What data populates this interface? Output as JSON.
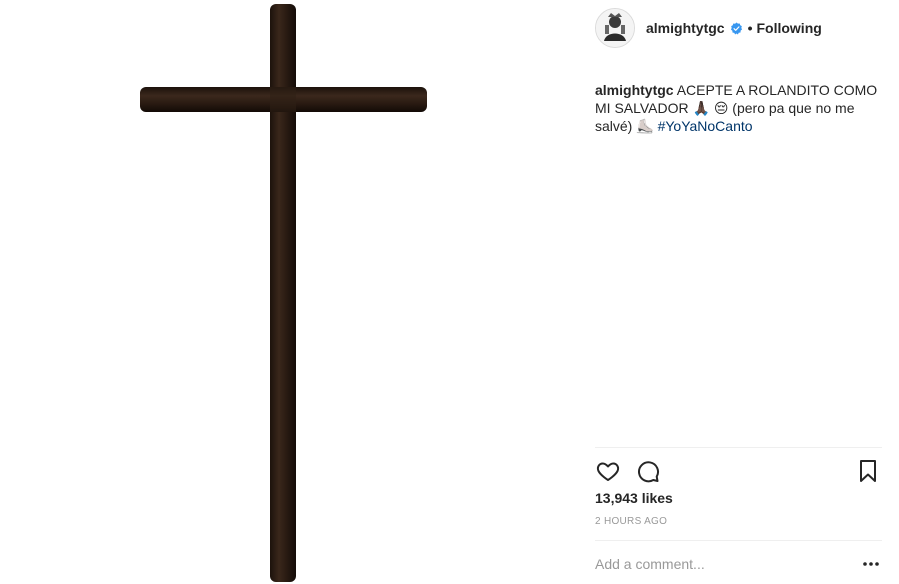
{
  "post": {
    "media": {
      "subject": "wooden-cross-image"
    },
    "header": {
      "username": "almightytgc",
      "separator": "•",
      "follow_label": "Following",
      "verified_icon": "verified-badge-icon"
    },
    "caption": {
      "username": "almightytgc",
      "text": "ACEPTE A ROLANDITO COMO MI SALVADOR 🙏🏿 😔 (pero pa que no me salvé) ⛸️",
      "hashtag": "#YoYaNoCanto"
    },
    "actions": {
      "like_icon": "heart-icon",
      "comment_icon": "comment-icon",
      "save_icon": "bookmark-icon"
    },
    "likes": "13,943 likes",
    "timestamp": "2 HOURS AGO",
    "comment_placeholder": "Add a comment...",
    "more_icon": "more-options-icon",
    "colors": {
      "text": "#262626",
      "muted": "#999999",
      "hashtag": "#003569",
      "verified": "#3897f0",
      "divider": "#efefef"
    }
  }
}
